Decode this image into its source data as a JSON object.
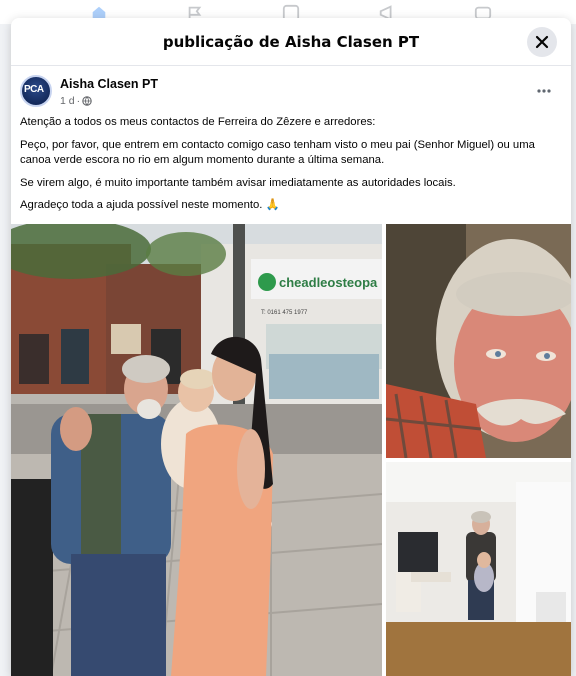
{
  "modal": {
    "title": "publicação de Aisha Clasen PT"
  },
  "post": {
    "author": "Aisha Clasen PT",
    "avatar_text": "PCA",
    "time": "1 d",
    "paragraphs": [
      "Atenção a todos os meus contactos de Ferreira do Zêzere e arredores:",
      "Peço, por favor, que entrem em contacto comigo caso tenham visto o meu pai (Senhor Miguel) ou uma canoa verde escora no rio em algum momento durante a última semana.",
      "Se virem algo, é muito importante também avisar imediatamente as autoridades locais.",
      "Agradeço toda a ajuda possível neste momento. 🙏"
    ],
    "photo_sign_text": "cheadleosteopa",
    "photo_phone_text": "T: 0161 475 1977"
  },
  "colors": {
    "accent": "#1877f2",
    "text": "#050505",
    "muted": "#65676b"
  }
}
